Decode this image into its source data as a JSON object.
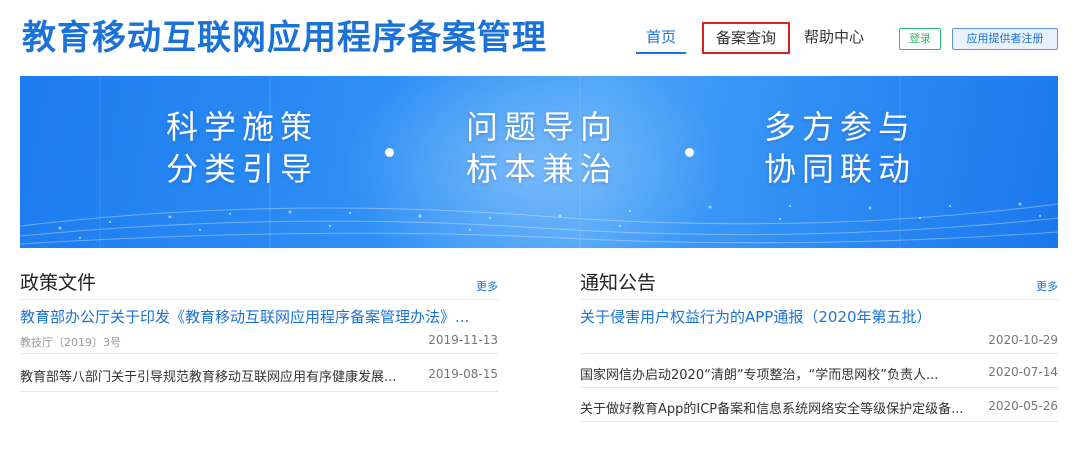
{
  "header": {
    "site_title": "教育移动互联网应用程序备案管理",
    "nav": {
      "home": "首页",
      "query": "备案查询",
      "help": "帮助中心"
    },
    "login": "登录",
    "register": "应用提供者注册"
  },
  "banner": {
    "slogans": [
      {
        "line1": "科学施策",
        "line2": "分类引导"
      },
      {
        "line1": "问题导向",
        "line2": "标本兼治"
      },
      {
        "line1": "多方参与",
        "line2": "协同联动"
      }
    ]
  },
  "policy": {
    "title": "政策文件",
    "more": "更多",
    "items": [
      {
        "title": "教育部办公厅关于印发《教育移动互联网应用程序备案管理办法》...",
        "sub": "教技厅〔2019〕3号",
        "date": "2019-11-13"
      },
      {
        "title": "教育部等八部门关于引导规范教育移动互联网应用有序健康发展...",
        "date": "2019-08-15"
      }
    ]
  },
  "notice": {
    "title": "通知公告",
    "more": "更多",
    "items": [
      {
        "title": "关于侵害用户权益行为的APP通报（2020年第五批）",
        "date": "2020-10-29"
      },
      {
        "title": "国家网信办启动2020“清朗”专项整治，“学而思网校”负责人...",
        "date": "2020-07-14"
      },
      {
        "title": "关于做好教育App的ICP备案和信息系统网络安全等级保护定级备...",
        "date": "2020-05-26"
      }
    ]
  },
  "colors": {
    "brand_blue": "#1a72d8",
    "highlight_red": "#e02020",
    "login_green": "#2ebd6e"
  }
}
